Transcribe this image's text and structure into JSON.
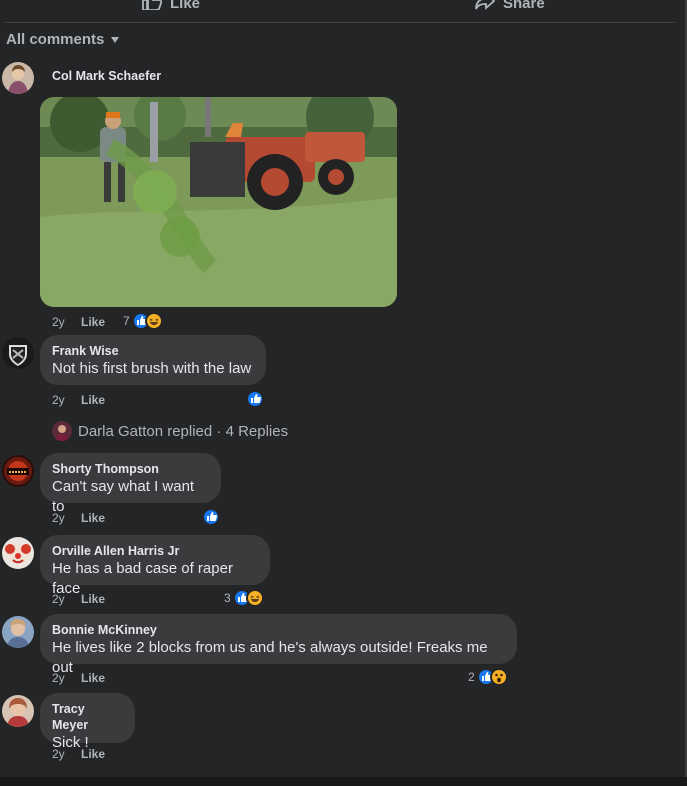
{
  "actions": {
    "like_label": "Like",
    "share_label": "Share"
  },
  "sort": {
    "label": "All comments"
  },
  "comments": [
    {
      "author": "Col Mark Schaefer",
      "time": "2y",
      "like_label": "Like",
      "reaction_count": "7"
    },
    {
      "author": "Frank Wise",
      "text": "Not his first brush with the law",
      "time": "2y",
      "like_label": "Like"
    },
    {
      "author": "Shorty Thompson",
      "text": "Can't say what I want to",
      "time": "2y",
      "like_label": "Like"
    },
    {
      "author": "Orville Allen Harris Jr",
      "text": "He has a bad case of raper face",
      "time": "2y",
      "like_label": "Like",
      "reaction_count": "3"
    },
    {
      "author": "Bonnie McKinney",
      "text": "He lives like 2 blocks from us and he's always outside! Freaks me out",
      "time": "2y",
      "like_label": "Like",
      "reaction_count": "2"
    },
    {
      "author": "Tracy Meyer",
      "text": "Sick !",
      "time": "2y",
      "like_label": "Like"
    }
  ],
  "replies": {
    "label": "Darla Gatton replied · 4 Replies"
  },
  "colors": {
    "background": "#242526",
    "bubble": "#3a3b3c",
    "accent": "#1877f2",
    "muted_text": "#b0b3b8"
  }
}
